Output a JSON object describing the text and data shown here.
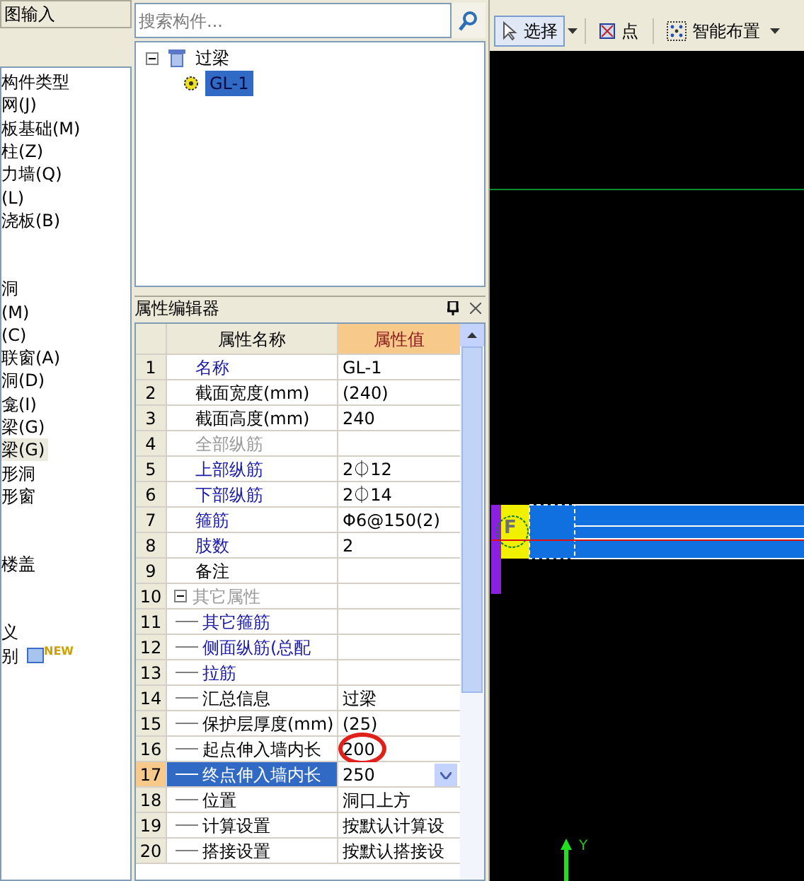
{
  "left_panel": {
    "header": "图输入",
    "groups": [
      {
        "items": [
          {
            "label": "构件类型",
            "selected": false
          },
          {
            "label": "网(J)",
            "selected": false
          },
          {
            "label": "板基础(M)",
            "selected": false
          },
          {
            "label": "柱(Z)",
            "selected": false
          },
          {
            "label": "力墙(Q)",
            "selected": false
          },
          {
            "label": "(L)",
            "selected": false
          },
          {
            "label": "浇板(B)",
            "selected": false
          }
        ]
      },
      {
        "items": [
          {
            "label": "洞",
            "selected": false
          },
          {
            "label": "(M)",
            "selected": false
          },
          {
            "label": "(C)",
            "selected": false
          },
          {
            "label": "联窗(A)",
            "selected": false
          },
          {
            "label": "洞(D)",
            "selected": false
          },
          {
            "label": "龛(I)",
            "selected": false
          },
          {
            "label": "梁(G)",
            "selected": false
          },
          {
            "label": "梁(G)",
            "selected": true
          },
          {
            "label": "形洞",
            "selected": false
          },
          {
            "label": "形窗",
            "selected": false
          }
        ]
      },
      {
        "items": [
          {
            "label": "楼盖",
            "selected": false
          }
        ]
      },
      {
        "items": [
          {
            "label": "义",
            "selected": false
          },
          {
            "label": "别",
            "selected": false,
            "badge": "NEW"
          }
        ]
      }
    ]
  },
  "search": {
    "placeholder": "搜索构件..."
  },
  "tree": [
    {
      "label": "过梁",
      "expanded": true,
      "children": [
        {
          "label": "GL-1",
          "selected": true
        }
      ]
    }
  ],
  "property_editor": {
    "title": "属性编辑器",
    "columns": [
      "属性名称",
      "属性值"
    ],
    "rows": [
      {
        "num": "1",
        "name": "名称",
        "kind": "link",
        "value": "GL-1",
        "selected": false
      },
      {
        "num": "2",
        "name": "截面宽度(mm)",
        "kind": "plain",
        "value": "(240)",
        "selected": false
      },
      {
        "num": "3",
        "name": "截面高度(mm)",
        "kind": "plain",
        "value": "240",
        "selected": false
      },
      {
        "num": "4",
        "name": "全部纵筋",
        "kind": "disabled",
        "selected": false
      },
      {
        "num": "5",
        "name": "上部纵筋",
        "kind": "link",
        "value": "2⏀12",
        "selected": false
      },
      {
        "num": "6",
        "name": "下部纵筋",
        "kind": "link",
        "value": "2⏀14",
        "selected": false
      },
      {
        "num": "7",
        "name": "箍筋",
        "kind": "link",
        "value": "Φ6@150(2)",
        "selected": false
      },
      {
        "num": "8",
        "name": "肢数",
        "kind": "link",
        "value": "2",
        "selected": false
      },
      {
        "num": "9",
        "name": "备注",
        "kind": "plain",
        "selected": false
      },
      {
        "num": "10",
        "name": "其它属性",
        "kind": "disabled",
        "selected": false,
        "expanded": true,
        "children": [
          {
            "num": "11",
            "name": "其它箍筋",
            "kind": "link",
            "selected": false
          },
          {
            "num": "12",
            "name": "侧面纵筋(总配",
            "kind": "link",
            "selected": false
          },
          {
            "num": "13",
            "name": "拉筋",
            "kind": "link",
            "selected": false
          },
          {
            "num": "14",
            "name": "汇总信息",
            "kind": "plain",
            "value": "过梁",
            "selected": false
          },
          {
            "num": "15",
            "name": "保护层厚度(mm)",
            "kind": "plain",
            "value": "(25)",
            "selected": false
          },
          {
            "num": "16",
            "name": "起点伸入墙内长",
            "kind": "plain",
            "value": "200",
            "selected": false,
            "circled": true
          },
          {
            "num": "17",
            "name": "终点伸入墙内长",
            "value": "250",
            "selected": true,
            "dropdown": true
          },
          {
            "num": "18",
            "name": "位置",
            "kind": "plain",
            "value": "洞口上方",
            "selected": false
          },
          {
            "num": "19",
            "name": "计算设置",
            "kind": "plain",
            "value": "按默认计算设",
            "selected": false
          },
          {
            "num": "20",
            "name": "搭接设置",
            "kind": "plain",
            "value": "按默认搭接设",
            "selected": false
          }
        ]
      }
    ]
  },
  "toolbar": [
    {
      "label": "选择",
      "kind": "pointer",
      "dropdown": true,
      "selected": true
    },
    {
      "label": "点",
      "kind": "point",
      "dropdown": false,
      "selected": false
    },
    {
      "label": "智能布置",
      "kind": "grid",
      "dropdown": true,
      "selected": false
    }
  ],
  "canvas": {
    "marker": "F",
    "axis_label": "Y"
  }
}
